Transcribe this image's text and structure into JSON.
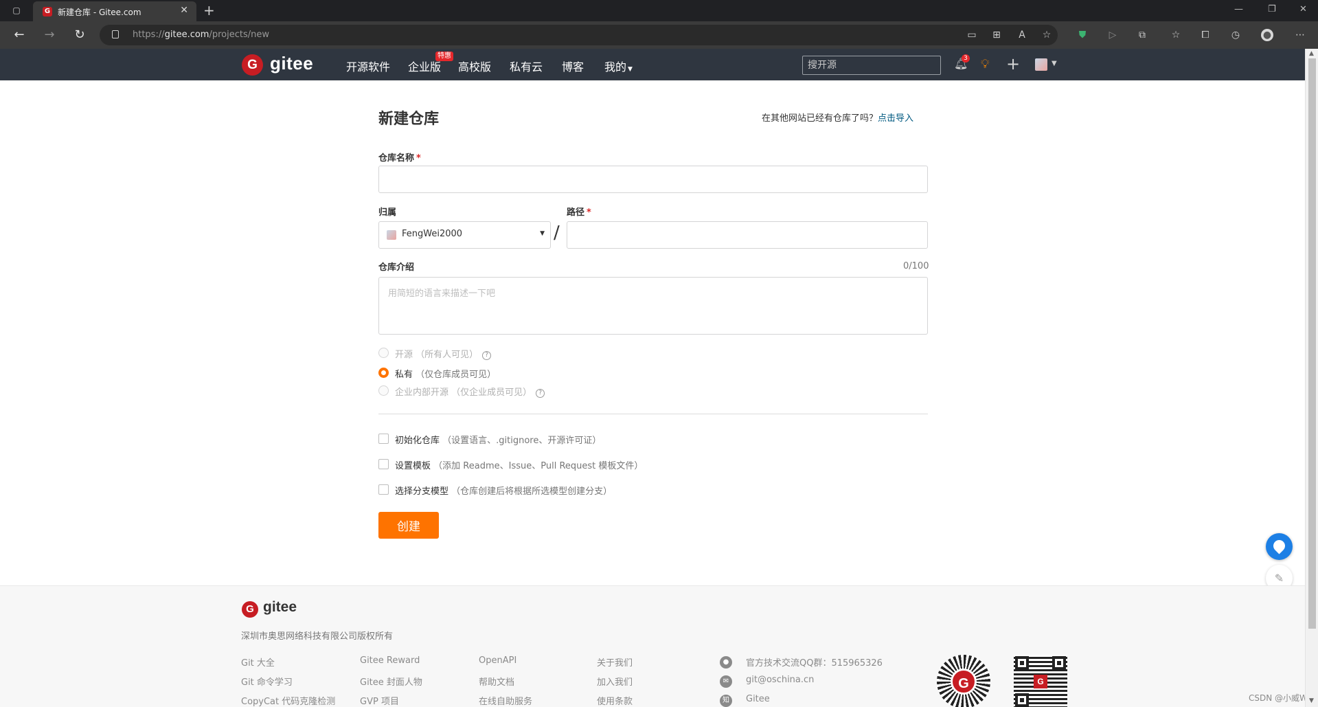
{
  "browser": {
    "tab_title": "新建仓库 - Gitee.com",
    "tab_favicon": "G",
    "new_tab_glyph": "+",
    "url_prefix": "https://",
    "url_host": "gitee.com",
    "url_path": "/projects/new"
  },
  "header": {
    "logo_text": "gitee",
    "nav": [
      "开源软件",
      "企业版",
      "高校版",
      "私有云",
      "博客",
      "我的"
    ],
    "special_badge": "特惠",
    "search_placeholder": "搜开源",
    "notification_count": "3"
  },
  "form": {
    "title": "新建仓库",
    "import_hint": "在其他网站已经有仓库了吗？",
    "import_link": "点击导入",
    "repo_name_label": "仓库名称",
    "required_mark": "*",
    "owner_label": "归属",
    "owner_value": "FengWei2000",
    "path_label": "路径",
    "path_separator": "/",
    "desc_label": "仓库介绍",
    "desc_counter": "0/100",
    "desc_placeholder": "用简短的语言来描述一下吧",
    "visibility": [
      {
        "label": "开源",
        "hint": "（所有人可见）",
        "checked": false,
        "disabled": true,
        "help": true
      },
      {
        "label": "私有",
        "hint": "（仅仓库成员可见）",
        "checked": true,
        "disabled": false,
        "help": false
      },
      {
        "label": "企业内部开源",
        "hint": "（仅企业成员可见）",
        "checked": false,
        "disabled": true,
        "help": true
      }
    ],
    "options": [
      {
        "label": "初始化仓库",
        "hint": "（设置语言、.gitignore、开源许可证）"
      },
      {
        "label": "设置模板",
        "hint": "（添加 Readme、Issue、Pull Request 模板文件）"
      },
      {
        "label": "选择分支模型",
        "hint": "（仓库创建后将根据所选模型创建分支）"
      }
    ],
    "create_label": "创建"
  },
  "footer": {
    "logo_text": "gitee",
    "copyright": "深圳市奥思网络科技有限公司版权所有",
    "col1": [
      "Git 大全",
      "Git 命令学习",
      "CopyCat 代码克隆检测"
    ],
    "col2": [
      "Gitee Reward",
      "Gitee 封面人物",
      "GVP 项目"
    ],
    "col3": [
      "OpenAPI",
      "帮助文档",
      "在线自助服务"
    ],
    "col4": [
      "关于我们",
      "加入我们",
      "使用条款"
    ],
    "contacts": [
      {
        "icon": "qq-icon",
        "text": "官方技术交流QQ群：515965326"
      },
      {
        "icon": "mail-icon",
        "text": "git@oschina.cn"
      },
      {
        "icon": "zhihu-icon",
        "glyph": "知",
        "text": "Gitee"
      }
    ],
    "watermark": "CSDN @小威W"
  },
  "colors": {
    "brand_red": "#c71d23",
    "accent_orange": "#fe7300",
    "header_bg": "#2f3640",
    "link_blue": "#005980"
  }
}
